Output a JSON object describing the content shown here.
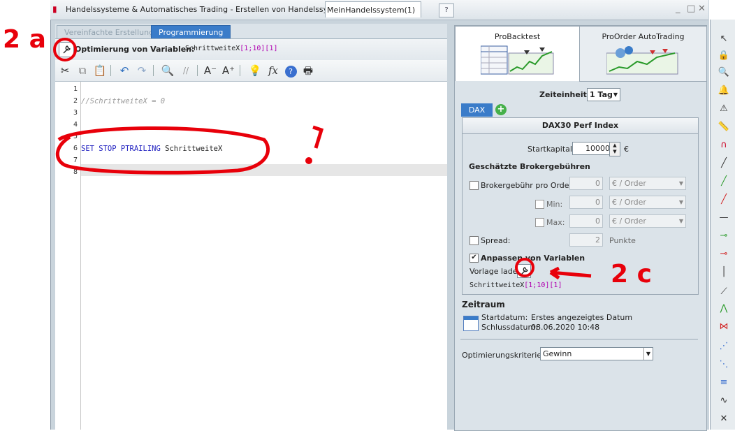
{
  "window": {
    "title": "Handelssysteme & Automatisches Trading - Erstellen von Handelssystemen",
    "doc_tab": "MeinHandelssystem(1)",
    "controls": [
      "_",
      "□",
      "✕"
    ]
  },
  "editor_tabs": {
    "simple": "Vereinfachte Erstellung",
    "programming": "Programmierung"
  },
  "optimization": {
    "label": "Optimierung von Variablen:",
    "var_name": "SchrittweiteX",
    "var_range": "[1;10][1]"
  },
  "code_lines": [
    {
      "num": "1",
      "text": ""
    },
    {
      "num": "2",
      "text": "//SchrittweiteX = 0"
    },
    {
      "num": "3",
      "text": ""
    },
    {
      "num": "4",
      "text": ""
    },
    {
      "num": "5",
      "text": ""
    },
    {
      "num": "6",
      "text": "SET STOP PTRAILING SchrittweiteX"
    },
    {
      "num": "7",
      "text": ""
    },
    {
      "num": "8",
      "text": ""
    }
  ],
  "right_tabs": {
    "backtest": "ProBacktest",
    "autotrading": "ProOrder AutoTrading"
  },
  "timeframe": {
    "label": "Zeiteinheit:",
    "value": "1 Tag"
  },
  "instrument_tab": "DAX",
  "instrument_name": "DAX30 Perf Index",
  "capital": {
    "label": "Startkapital :",
    "value": "10000",
    "currency": "€"
  },
  "broker": {
    "heading": "Geschätzte Brokergebühren",
    "per_order_label": "Brokergebühr pro Order :",
    "per_order_value": "0",
    "unit": "€ / Order",
    "min_label": "Min:",
    "min_value": "0",
    "max_label": "Max:",
    "max_value": "0",
    "spread_label": "Spread:",
    "spread_value": "2",
    "spread_unit": "Punkte"
  },
  "adjust_vars": {
    "label": "Anpassen von Variablen",
    "template_label": "Vorlage laden",
    "var_name": "SchrittweiteX",
    "var_range": "[1;10][1]"
  },
  "period": {
    "heading": "Zeitraum",
    "start_label": "Startdatum:",
    "start_value": "Erstes angezeigtes Datum",
    "end_label": "Schlussdatum:",
    "end_value": "08.06.2020 10:48"
  },
  "criteria": {
    "label": "Optimierungskriterien :",
    "value": "Gewinn"
  },
  "annotations": {
    "a": "2 a",
    "c": "2 c",
    "mark": "!"
  },
  "colors": {
    "accent": "#3a7cc9",
    "annotation": "#e8000a"
  }
}
